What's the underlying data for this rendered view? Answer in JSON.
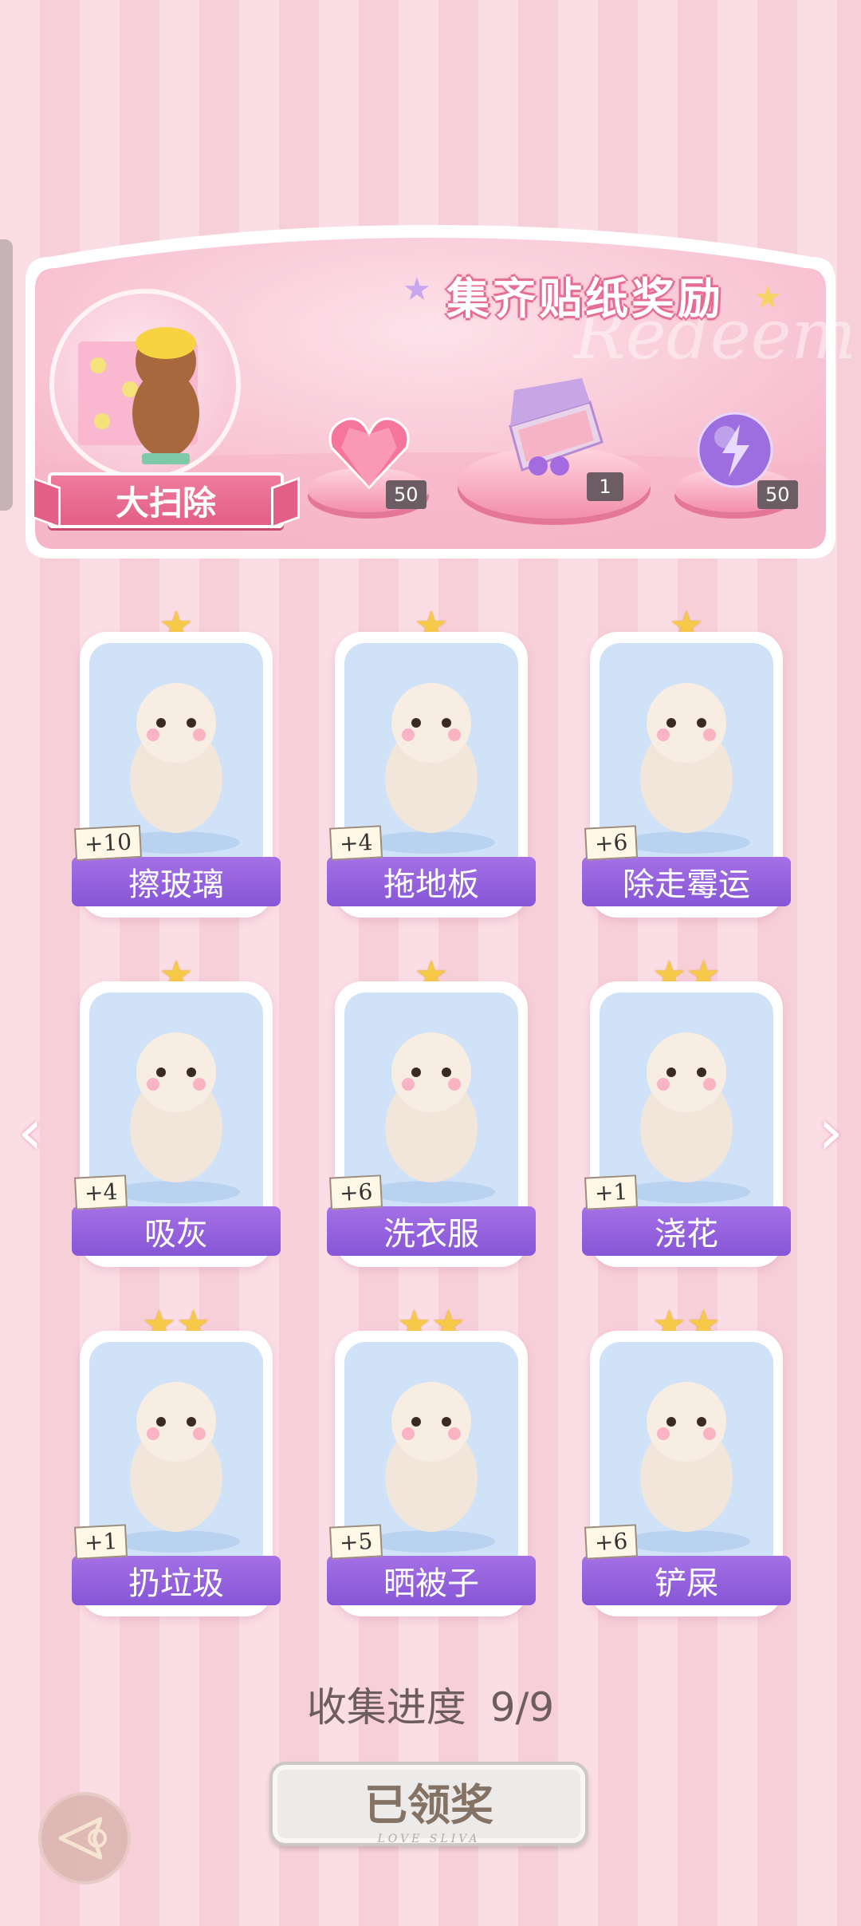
{
  "banner": {
    "title": "集齐贴纸奖励",
    "watermark": "Redeem",
    "main_label": "大扫除",
    "rewards": [
      {
        "icon": "heart-gem-icon",
        "count": "50"
      },
      {
        "icon": "gift-box-icon",
        "count": "1"
      },
      {
        "icon": "lightning-orb-icon",
        "count": "50"
      }
    ]
  },
  "cards": [
    {
      "name": "擦玻璃",
      "bonus": "+10",
      "stars": "★",
      "icon": "cat-cleaning-window-icon",
      "art_color": "#cfe2f8"
    },
    {
      "name": "拖地板",
      "bonus": "+4",
      "stars": "★",
      "icon": "corgi-mopping-icon",
      "art_color": "#cfe2f8"
    },
    {
      "name": "除走霉运",
      "bonus": "+6",
      "stars": "★",
      "icon": "panda-broom-icon",
      "art_color": "#cfe2f8"
    },
    {
      "name": "吸灰",
      "bonus": "+4",
      "stars": "★",
      "icon": "girl-vacuum-icon",
      "art_color": "#cfe2f8"
    },
    {
      "name": "洗衣服",
      "bonus": "+6",
      "stars": "★",
      "icon": "washing-machine-cat-icon",
      "art_color": "#cfe2f8"
    },
    {
      "name": "浇花",
      "bonus": "+1",
      "stars": "★★",
      "icon": "cat-watering-plant-icon",
      "art_color": "#cfe2f8"
    },
    {
      "name": "扔垃圾",
      "bonus": "+1",
      "stars": "★★",
      "icon": "girl-trash-bags-icon",
      "art_color": "#cfe2f8"
    },
    {
      "name": "晒被子",
      "bonus": "+5",
      "stars": "★★",
      "icon": "bear-quilt-icon",
      "art_color": "#cfe2f8"
    },
    {
      "name": "铲屎",
      "bonus": "+6",
      "stars": "★★",
      "icon": "girl-litter-box-icon",
      "art_color": "#cfe2f8"
    }
  ],
  "progress": {
    "label": "收集进度",
    "value": "9/9"
  },
  "claim_button": {
    "label": "已领奖",
    "sub": "LOVE SLIVA"
  },
  "nav": {
    "prev": "‹",
    "next": "›"
  }
}
